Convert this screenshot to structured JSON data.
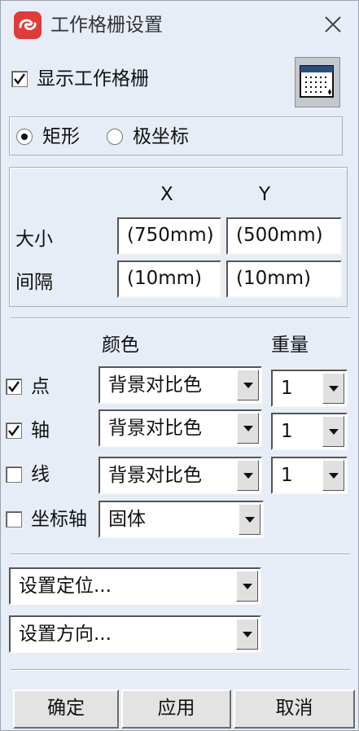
{
  "window": {
    "title": "工作格栅设置",
    "accent_color": "#e03b3b"
  },
  "show_grid": {
    "label": "显示工作格栅",
    "checked": true
  },
  "grid_type": {
    "options": [
      {
        "label": "矩形",
        "selected": true
      },
      {
        "label": "极坐标",
        "selected": false
      }
    ]
  },
  "size_group": {
    "x_header": "X",
    "y_header": "Y",
    "size_label": "大小",
    "size_x": "(750mm)",
    "size_y": "(500mm)",
    "spacing_label": "间隔",
    "spacing_x": "(10mm)",
    "spacing_y": "(10mm)"
  },
  "appearance": {
    "color_header": "颜色",
    "weight_header": "重量",
    "rows": [
      {
        "label": "点",
        "checked": true,
        "color": "背景对比色",
        "weight": "1"
      },
      {
        "label": "轴",
        "checked": true,
        "color": "背景对比色",
        "weight": "1"
      },
      {
        "label": "线",
        "checked": false,
        "color": "背景对比色",
        "weight": "1"
      },
      {
        "label": "坐标轴",
        "checked": false,
        "color": "固体"
      }
    ]
  },
  "set_position": "设置定位...",
  "set_direction": "设置方向...",
  "buttons": {
    "ok": "确定",
    "apply": "应用",
    "cancel": "取消"
  }
}
